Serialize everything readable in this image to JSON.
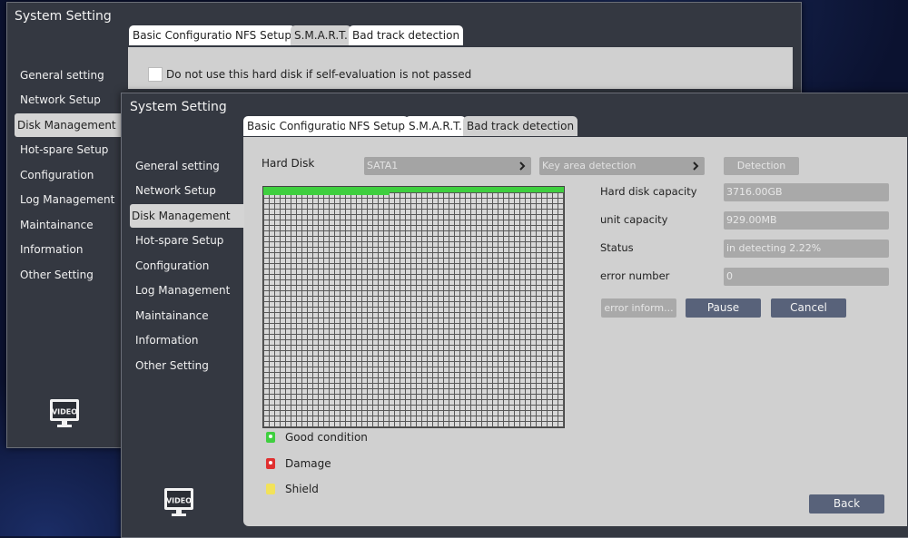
{
  "back_window": {
    "title": "System Setting",
    "sidebar": [
      {
        "label": "General setting"
      },
      {
        "label": "Network Setup"
      },
      {
        "label": "Disk Management"
      },
      {
        "label": "Hot-spare Setup"
      },
      {
        "label": "Configuration"
      },
      {
        "label": "Log Management"
      },
      {
        "label": "Maintainance"
      },
      {
        "label": "Information"
      },
      {
        "label": "Other Setting"
      }
    ],
    "tabs": [
      {
        "label": "Basic Configuration"
      },
      {
        "label": "NFS Setup"
      },
      {
        "label": "S.M.A.R.T."
      },
      {
        "label": "Bad track detection"
      }
    ],
    "checkbox_label": "Do not use this hard disk if self-evaluation is not passed",
    "logo_text": "VIDEO"
  },
  "front_window": {
    "title": "System Setting",
    "sidebar": [
      {
        "label": "General setting"
      },
      {
        "label": "Network Setup"
      },
      {
        "label": "Disk Management"
      },
      {
        "label": "Hot-spare Setup"
      },
      {
        "label": "Configuration"
      },
      {
        "label": "Log Management"
      },
      {
        "label": "Maintainance"
      },
      {
        "label": "Information"
      },
      {
        "label": "Other Setting"
      }
    ],
    "tabs": [
      {
        "label": "Basic Configuration"
      },
      {
        "label": "NFS Setup"
      },
      {
        "label": "S.M.A.R.T."
      },
      {
        "label": "Bad track detection"
      }
    ],
    "hard_disk_label": "Hard Disk",
    "hard_disk_value": "SATA1",
    "detection_mode_value": "Key area detection",
    "detection_button": "Detection",
    "fields": [
      {
        "label": "Hard disk capacity",
        "value": "3716.00GB"
      },
      {
        "label": "unit capacity",
        "value": "929.00MB"
      },
      {
        "label": "Status",
        "value": "in detecting 2.22%"
      },
      {
        "label": "error number",
        "value": "0"
      }
    ],
    "error_info_button": "error inform...",
    "pause_button": "Pause",
    "cancel_button": "Cancel",
    "back_button": "Back",
    "legend": [
      {
        "label": "Good condition",
        "color": "#3fcf3f"
      },
      {
        "label": "Damage",
        "color": "#e03030"
      },
      {
        "label": "Shield",
        "color": "#f2e25a"
      }
    ],
    "progress_fraction": 0.0222,
    "logo_text": "VIDEO"
  },
  "colors": {
    "window_bg": "#343841",
    "panel_bg": "#d0d0d0",
    "button_dark": "#58627a",
    "good": "#3fcf3f"
  }
}
